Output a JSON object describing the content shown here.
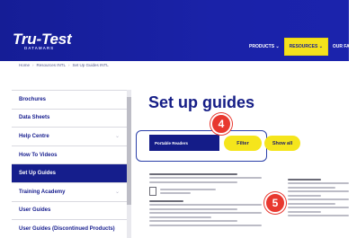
{
  "header": {
    "logo_main": "Tru-Test",
    "logo_sub": "DATAMARS",
    "nav": [
      {
        "label": "PRODUCTS ⌄",
        "active": false
      },
      {
        "label": "RESOURCES ⌄",
        "active": true
      },
      {
        "label": "OUR FARM",
        "active": false
      }
    ]
  },
  "breadcrumb": [
    "Home",
    "Resources INTL",
    "Set Up Guides INTL"
  ],
  "sidebar": {
    "items": [
      {
        "label": "Brochures",
        "chevron": false,
        "active": false
      },
      {
        "label": "Data Sheets",
        "chevron": false,
        "active": false
      },
      {
        "label": "Help Centre",
        "chevron": true,
        "active": false
      },
      {
        "label": "How To Videos",
        "chevron": false,
        "active": false
      },
      {
        "label": "Set Up Guides",
        "chevron": false,
        "active": true
      },
      {
        "label": "Training Academy",
        "chevron": true,
        "active": false
      },
      {
        "label": "User Guides",
        "chevron": false,
        "active": false
      },
      {
        "label": "User Guides (Discontinued Products)",
        "chevron": false,
        "active": false
      }
    ]
  },
  "main": {
    "title": "Set up guides",
    "select_value": "Portable Readers",
    "filter_label": "Filter",
    "show_all_label": "Show all",
    "badge_4": "4",
    "badge_5": "5"
  },
  "colors": {
    "brand_blue": "#151d96",
    "accent_yellow": "#f5e51c",
    "badge_red": "#e8382f"
  }
}
